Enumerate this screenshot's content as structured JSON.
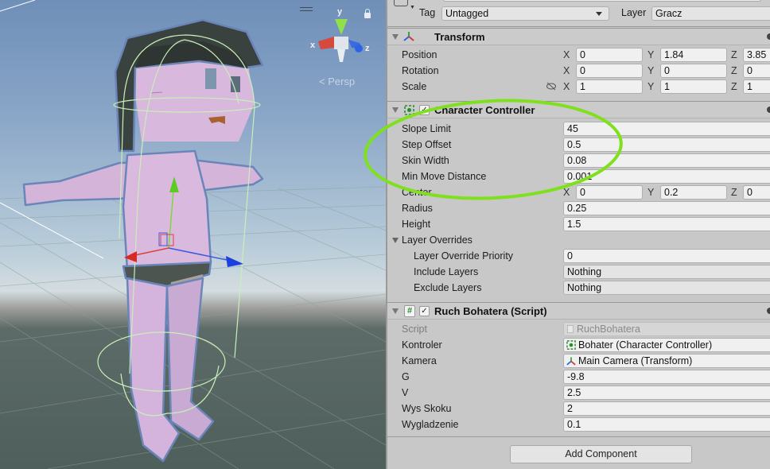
{
  "scene": {
    "gizmo": {
      "axis_x": "x",
      "axis_y": "y",
      "axis_z": "z"
    },
    "projection_label": "< Persp",
    "colors": {
      "axis_x": "#d64a3e",
      "axis_y": "#8fe04a",
      "axis_z": "#3a6be0",
      "character": "#d9b8dc",
      "hair": "#3b4340",
      "collider": "#c8f0b8"
    }
  },
  "inspector": {
    "tag_label": "Tag",
    "tag_value": "Untagged",
    "layer_label": "Layer",
    "layer_value": "Gracz",
    "transform": {
      "title": "Transform",
      "rows": [
        {
          "label": "Position",
          "x": "0",
          "y": "1.84",
          "z": "3.85"
        },
        {
          "label": "Rotation",
          "x": "0",
          "y": "0",
          "z": "0"
        },
        {
          "label": "Scale",
          "x": "1",
          "y": "1",
          "z": "1"
        }
      ],
      "axis_labels": {
        "x": "X",
        "y": "Y",
        "z": "Z"
      }
    },
    "character_controller": {
      "title": "Character Controller",
      "enabled": "✓",
      "slope_limit": {
        "label": "Slope Limit",
        "value": "45"
      },
      "step_offset": {
        "label": "Step Offset",
        "value": "0.5"
      },
      "skin_width": {
        "label": "Skin Width",
        "value": "0.08"
      },
      "min_move_distance": {
        "label": "Min Move Distance",
        "value": "0.001"
      },
      "center": {
        "label": "Center",
        "x": "0",
        "y": "0.2",
        "z": "0"
      },
      "radius": {
        "label": "Radius",
        "value": "0.25"
      },
      "height": {
        "label": "Height",
        "value": "1.5"
      },
      "layer_overrides": {
        "label": "Layer Overrides",
        "priority": {
          "label": "Layer Override Priority",
          "value": "0"
        },
        "include": {
          "label": "Include Layers",
          "value": "Nothing"
        },
        "exclude": {
          "label": "Exclude Layers",
          "value": "Nothing"
        }
      }
    },
    "script_component": {
      "title": "Ruch Bohatera (Script)",
      "enabled": "✓",
      "icon_glyph": "#",
      "script": {
        "label": "Script",
        "value": "RuchBohatera"
      },
      "kontroler": {
        "label": "Kontroler",
        "value": "Bohater (Character Controller)"
      },
      "kamera": {
        "label": "Kamera",
        "value": "Main Camera (Transform)"
      },
      "g": {
        "label": "G",
        "value": "-9.8"
      },
      "v": {
        "label": "V",
        "value": "2.5"
      },
      "wys_skoku": {
        "label": "Wys Skoku",
        "value": "2"
      },
      "wygladzenie": {
        "label": "Wygladzenie",
        "value": "0.1"
      }
    },
    "add_component_label": "Add Component"
  },
  "annotation": {
    "color": "#7fe01e"
  }
}
